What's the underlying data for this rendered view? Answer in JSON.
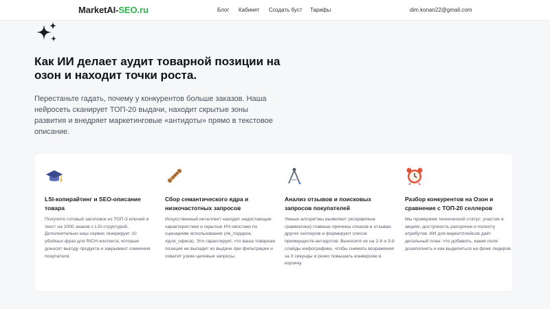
{
  "header": {
    "logo_main": "MarketAI-",
    "logo_accent": "SEO.ru",
    "nav": [
      {
        "label": "Блог"
      },
      {
        "label": "Кабинет"
      },
      {
        "label": "Создать буст"
      },
      {
        "label": "Тарифы"
      }
    ],
    "user_email": "dim.konan22@gmail.com"
  },
  "hero": {
    "icon": "sparkles-icon",
    "title": "Как ИИ делает аудит товарной позиции на озон и находит точки роста.",
    "subtitle": "Перестаньте гадать, почему у конкурентов больше заказов. Наша нейросеть сканирует ТОП-20 выдачи, находит скрытые зоны развития и внедряет маркетинговые «антидоты» прямо в текстовое описание."
  },
  "features": [
    {
      "icon": "graduation-cap-icon",
      "title": "LSI-копирайтинг и SEO-описание товара",
      "text": "Получите готовый заголовок из ТОП-3 ключей и текст на 2000 знаков с LSI-структурой. Дополнительно наш сервис генерирует 10 убойных фраз для RICH-контента, которые доносят выгоду продукта и закрывают сомнения покупателя."
    },
    {
      "icon": "flute-icon",
      "title": "Сбор семантического ядра и низкочастотных запросов",
      "text": "Искусственный интеллект находит недостающие характеристики и скрытые НЧ-хвостики по сценариям использования (#в_подарок, #для_офиса). Это гарантирует, что ваша товарная позиция не выпадет из выдачи при фильтрации и охватит узкие целевые запросы."
    },
    {
      "icon": "compass-icon",
      "title": "Анализ отзывов и поисковых запросов покупателей",
      "text": "Умные алгоритмы выявляют (исправлена грамматика) главные причины отказов в отзывах других селлеров и формируют список преимуществ-антидотов. Выносите их на 2-й и 3-й слайды инфографики, чтобы снимать возражения за 3 секунды и резко повышать конверсию в корзину."
    },
    {
      "icon": "alarm-clock-icon",
      "title": "Разбор конкурентов на Озон и сравнение с ТОП-20 селлеров",
      "text": "Мы проверяем технический статус: участие в акциях, доступность рассрочки и полноту атрибутов. ИИ для маркетплейсов даёт детальный план: что добавить, какие поля дозаполнить и как выделиться на фоне лидеров."
    }
  ],
  "colors": {
    "accent": "#2fb24b",
    "page_bg": "#f6f7f9",
    "card_bg": "#ffffff",
    "text_dark": "#111111",
    "text_muted": "#4a4f5c"
  }
}
